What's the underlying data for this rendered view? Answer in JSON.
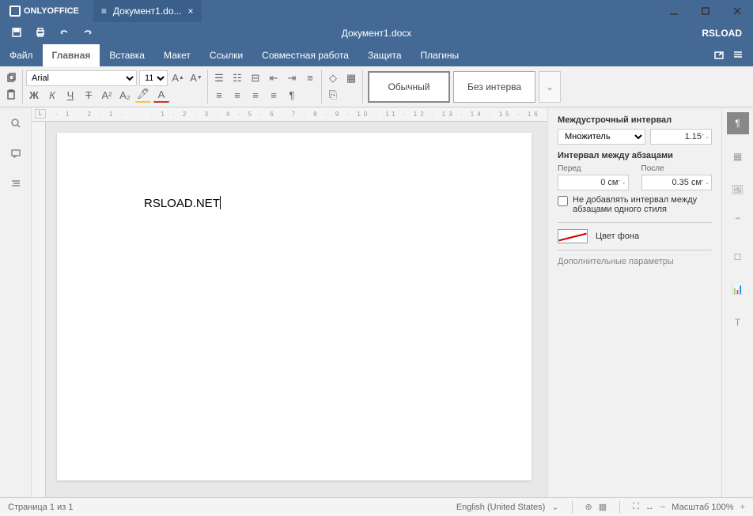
{
  "app": {
    "name": "ONLYOFFICE",
    "user": "RSLOAD"
  },
  "tab": {
    "label": "Документ1.do..."
  },
  "header": {
    "title": "Документ1.docx"
  },
  "menu": {
    "items": [
      "Файл",
      "Главная",
      "Вставка",
      "Макет",
      "Ссылки",
      "Совместная работа",
      "Защита",
      "Плагины"
    ],
    "active": 1
  },
  "toolbar": {
    "font_name": "Arial",
    "font_size": "11",
    "styles": [
      "Обычный",
      "Без интерва"
    ]
  },
  "document": {
    "text": "RSLOAD.NET"
  },
  "rightpanel": {
    "line_spacing_label": "Междустрочный интервал",
    "line_spacing_type": "Множитель",
    "line_spacing_value": "1.15",
    "para_spacing_label": "Интервал между абзацами",
    "before_label": "Перед",
    "before_value": "0 см",
    "after_label": "После",
    "after_value": "0.35 см",
    "checkbox_label": "Не добавлять интервал между абзацами одного стиля",
    "bg_label": "Цвет фона",
    "more_link": "Дополнительные параметры"
  },
  "statusbar": {
    "page": "Страница 1 из 1",
    "lang": "English (United States)",
    "zoom": "Масштаб 100%"
  }
}
